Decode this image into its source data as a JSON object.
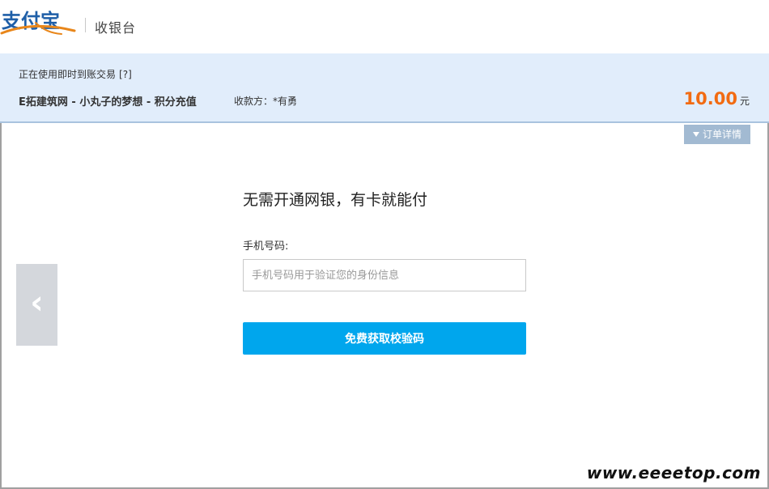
{
  "header": {
    "logo_text": "支付宝",
    "title": "收银台"
  },
  "order": {
    "mode_text": "正在使用即时到账交易",
    "help_label": "[?]",
    "title": "E拓建筑网 - 小丸子的梦想 - 积分充值",
    "payee": "收款方：*有勇",
    "amount": "10.00",
    "currency": "元"
  },
  "main": {
    "detail_button_label": "订单详情",
    "prev_arrow": "‹",
    "heading": "无需开通网银，有卡就能付",
    "phone_label": "手机号码:",
    "phone_placeholder": "手机号码用于验证您的身份信息",
    "phone_value": "",
    "submit_label": "免费获取校验码"
  },
  "watermark": "www.eeeetop.com",
  "colors": {
    "accent_blue": "#00a6ed",
    "amount_orange": "#f26b12",
    "order_bar_bg": "#e1edfb",
    "detail_button_bg": "#a2bad2",
    "logo_orange": "#e8861a",
    "logo_blue": "#1f5fa8"
  }
}
